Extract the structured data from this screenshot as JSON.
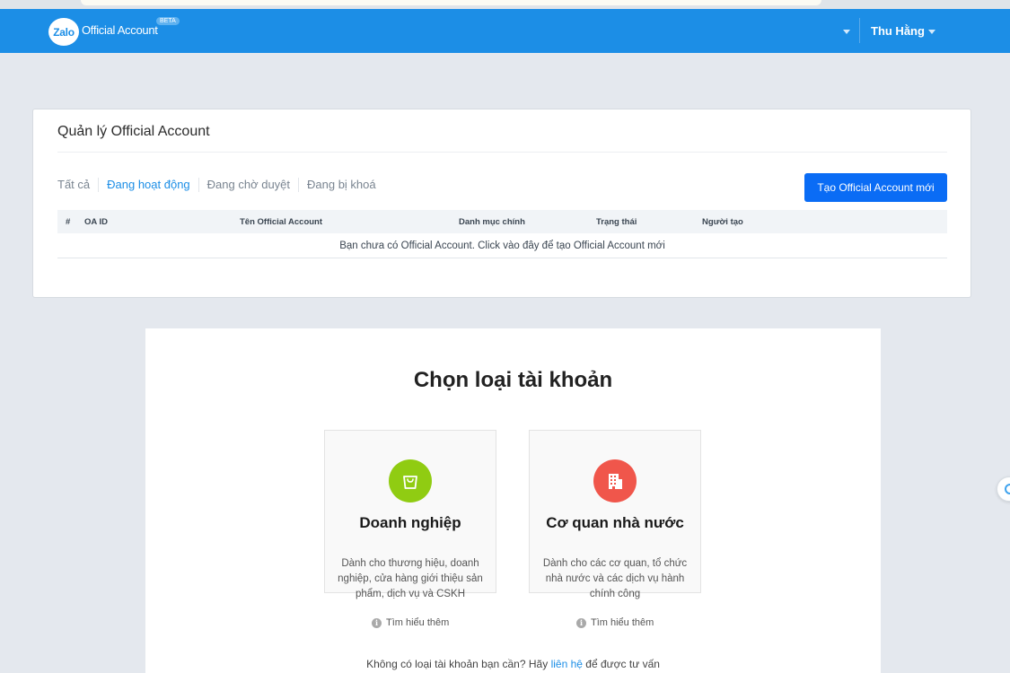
{
  "header": {
    "logo_mark": "Zalo",
    "logo_text": "Official Account",
    "beta_badge": "BETA",
    "username": "Thu Hằng"
  },
  "management": {
    "title": "Quản lý Official Account",
    "tabs": [
      {
        "label": "Tất cả"
      },
      {
        "label": "Đang hoạt động"
      },
      {
        "label": "Đang chờ duyệt"
      },
      {
        "label": "Đang bị khoá"
      }
    ],
    "active_tab": "Đang hoạt động",
    "create_button": "Tạo Official Account mới",
    "table": {
      "columns": [
        "#",
        "OA ID",
        "Tên Official Account",
        "Danh mục chính",
        "Trạng thái",
        "Người tạo"
      ],
      "empty_message": "Bạn chưa có Official Account. Click vào đây để tạo Official Account mới"
    }
  },
  "account_types": {
    "title": "Chọn loại tài khoản",
    "options": [
      {
        "name": "Doanh nghiệp",
        "description": "Dành cho thương hiệu, doanh nghiệp, cửa hàng giới thiệu sản phẩm, dịch vụ và CSKH",
        "learn_more": "Tìm hiểu thêm",
        "icon": "shopping-bag-icon",
        "color": "#90cc12"
      },
      {
        "name": "Cơ quan nhà nước",
        "description": "Dành cho các cơ quan, tổ chức nhà nước và các dịch vụ hành chính công",
        "learn_more": "Tìm hiểu thêm",
        "icon": "building-icon",
        "color": "#f0564b"
      }
    ],
    "footer_prefix": "Không có loại tài khoản bạn cần? Hãy",
    "footer_link": "liên hệ",
    "footer_suffix": "để được tư vấn"
  },
  "colors": {
    "header_blue": "#1c8ee6",
    "button_blue": "#0a6cf5",
    "page_background": "#e4e8ee"
  }
}
